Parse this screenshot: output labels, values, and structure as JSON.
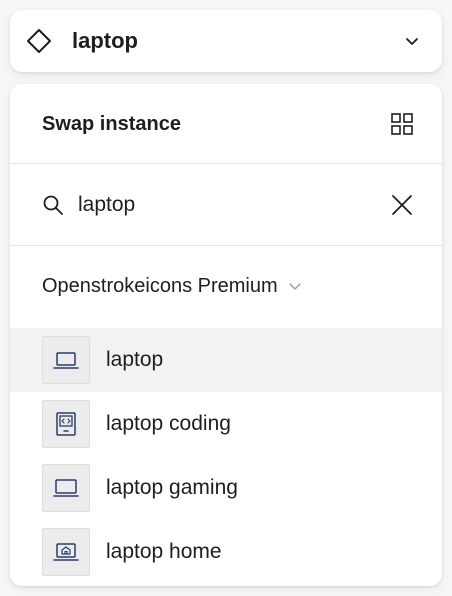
{
  "component": {
    "name": "laptop",
    "icon": "component-instance-diamond-icon"
  },
  "swap_panel": {
    "title": "Swap instance",
    "view_toggle_icon": "grid-view-icon"
  },
  "search": {
    "value": "laptop",
    "icon": "search-icon",
    "clear_icon": "close-icon"
  },
  "library": {
    "name": "Openstrokeicons Premium"
  },
  "results": [
    {
      "label": "laptop",
      "icon": "laptop-icon",
      "selected": true
    },
    {
      "label": "laptop coding",
      "icon": "laptop-coding-icon",
      "selected": false
    },
    {
      "label": "laptop gaming",
      "icon": "laptop-gaming-icon",
      "selected": false
    },
    {
      "label": "laptop home",
      "icon": "laptop-home-icon",
      "selected": false
    }
  ],
  "colors": {
    "icon_stroke": "#283c6b",
    "selected_row": "#f2f2f2",
    "text": "#1e1e1e"
  }
}
